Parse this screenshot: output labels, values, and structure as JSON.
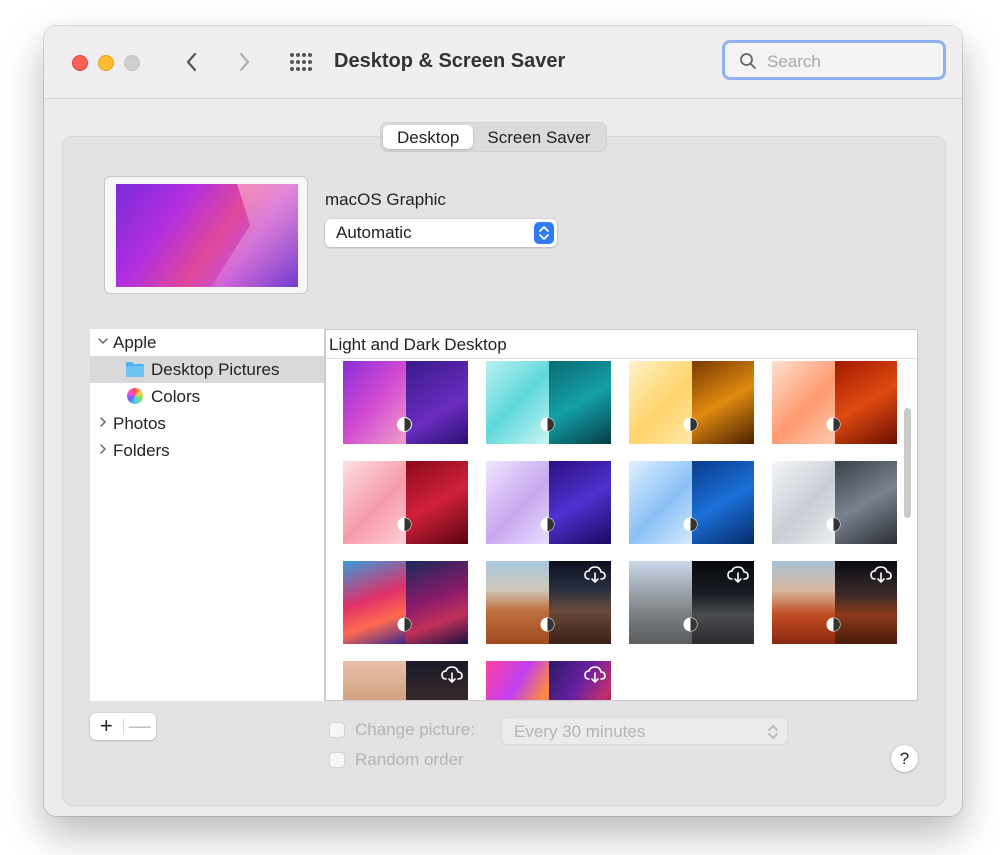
{
  "window": {
    "title": "Desktop & Screen Saver",
    "search_placeholder": "Search"
  },
  "tabs": [
    {
      "label": "Desktop",
      "active": true
    },
    {
      "label": "Screen Saver",
      "active": false
    }
  ],
  "current_wallpaper": {
    "name": "macOS Graphic",
    "mode": "Automatic"
  },
  "sidebar": {
    "items": [
      {
        "label": "Apple",
        "expanded": true
      },
      {
        "label": "Desktop Pictures",
        "selected": true,
        "icon": "folder-icon"
      },
      {
        "label": "Colors",
        "icon": "color-wheel-icon"
      },
      {
        "label": "Photos",
        "expanded": false
      },
      {
        "label": "Folders",
        "expanded": false
      }
    ]
  },
  "browser": {
    "section_title": "Light and Dark Desktop",
    "thumbnails": [
      {
        "theme": "monterey-purple",
        "badge": "dynamic-icon"
      },
      {
        "theme": "teal",
        "badge": "dynamic-icon"
      },
      {
        "theme": "yellow",
        "badge": "dynamic-icon"
      },
      {
        "theme": "orange",
        "badge": "dynamic-icon"
      },
      {
        "theme": "red",
        "badge": "dynamic-icon"
      },
      {
        "theme": "lavender",
        "badge": "dynamic-icon"
      },
      {
        "theme": "blue",
        "badge": "dynamic-icon"
      },
      {
        "theme": "silver",
        "badge": "dynamic-icon"
      },
      {
        "theme": "big-sur-graphic",
        "badge": "dynamic-icon"
      },
      {
        "theme": "rock-formation",
        "badge": "dynamic-icon",
        "download": "cloud-download-icon"
      },
      {
        "theme": "gray-rock",
        "badge": "dynamic-icon",
        "download": "cloud-download-icon"
      },
      {
        "theme": "red-rock",
        "badge": "dynamic-icon",
        "download": "cloud-download-icon"
      },
      {
        "theme": "sunset-rock",
        "download": "cloud-download-icon"
      },
      {
        "theme": "neon",
        "download": "cloud-download-icon"
      }
    ]
  },
  "footer": {
    "add_label": "+",
    "remove_label": "—",
    "change_picture_label": "Change picture:",
    "interval_value": "Every 30 minutes",
    "random_order_label": "Random order",
    "help_label": "?"
  },
  "colors": {
    "accent": "#2f7cf6",
    "close": "#fe5f57",
    "minimize": "#febc2e",
    "zoom_disabled": "#d0d0d0",
    "search_focus": "#8fb1ec"
  }
}
